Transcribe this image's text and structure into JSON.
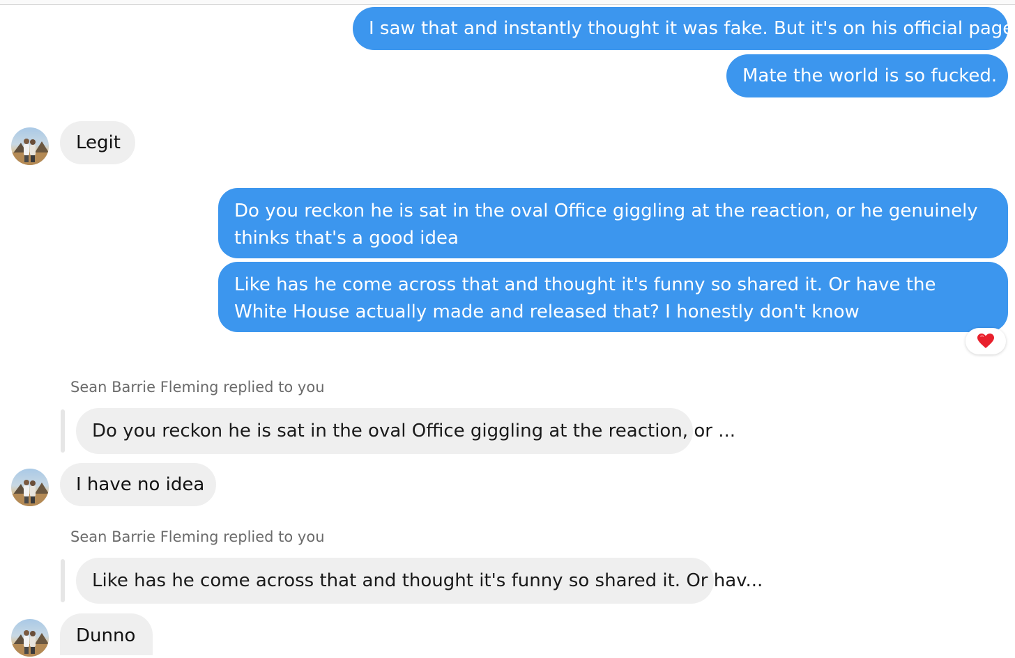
{
  "messages": {
    "m1": "I saw that and instantly thought it was fake. But it's on his official page",
    "m2": "Mate the world is so fucked.",
    "m3": "Legit",
    "m4": "Do you reckon he is sat in the oval Office giggling at the reaction, or he genuinely thinks that's a good idea",
    "m5": "Like has he come across that and thought it's funny so shared it. Or have the White House actually made and released that? I honestly don't know",
    "m6": "I have no idea",
    "m7": "Dunno"
  },
  "replies": {
    "r1_label": "Sean Barrie Fleming replied to you",
    "r1_quote": "Do you reckon he is sat in the oval Office giggling at the reaction, or ...",
    "r2_label": "Sean Barrie Fleming replied to you",
    "r2_quote": "Like has he come across that and thought it's funny so shared it. Or hav..."
  },
  "reaction": {
    "icon": "heart-icon",
    "color": "#e8202c"
  },
  "colors": {
    "outgoing_bubble": "#3c96ee",
    "incoming_bubble": "#efefef",
    "reply_label": "#6b6b6b"
  }
}
